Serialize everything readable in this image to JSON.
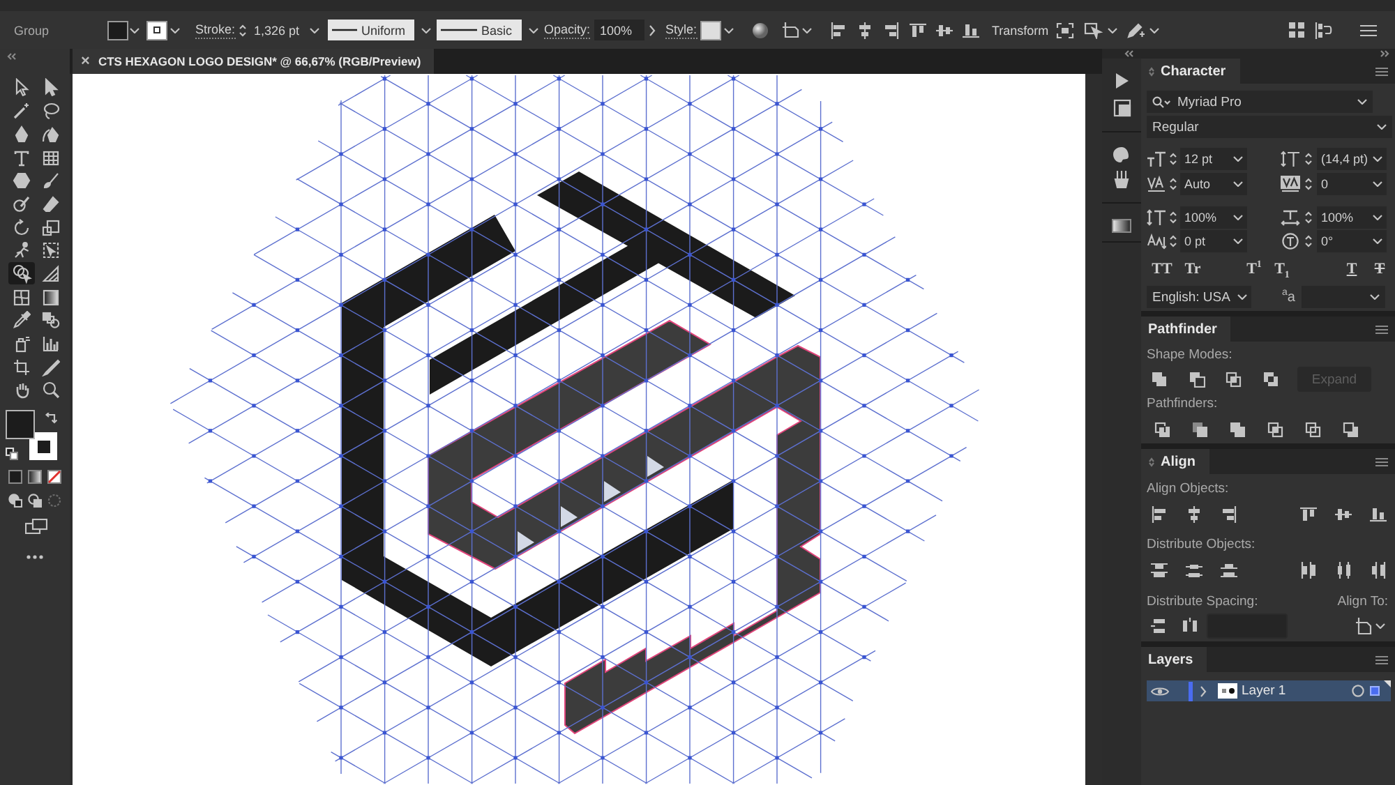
{
  "control_bar": {
    "selection": "Group",
    "stroke_label": "Stroke:",
    "stroke_weight": "1,326 pt",
    "profile": "Uniform",
    "brush": "Basic",
    "opacity_label": "Opacity:",
    "opacity": "100%",
    "style_label": "Style:",
    "transform_label": "Transform"
  },
  "document_tab": {
    "close": "×",
    "title": "CTS HEXAGON LOGO DESIGN* @ 66,67% (RGB/Preview)"
  },
  "tools": [
    {
      "selected": false
    },
    {
      "selected": false
    },
    {
      "selected": false
    },
    {
      "selected": false
    },
    {
      "selected": false
    },
    {
      "selected": false
    },
    {
      "selected": false
    },
    {
      "selected": false
    },
    {
      "selected": false
    },
    {
      "selected": false
    },
    {
      "selected": false
    },
    {
      "selected": false
    },
    {
      "selected": false
    },
    {
      "selected": false
    },
    {
      "selected": false
    },
    {
      "selected": false
    },
    {
      "selected": true
    },
    {
      "selected": false
    },
    {
      "selected": false
    },
    {
      "selected": false
    },
    {
      "selected": false
    },
    {
      "selected": false
    },
    {
      "selected": false
    },
    {
      "selected": false
    },
    {
      "selected": false
    },
    {
      "selected": false
    },
    {
      "selected": false
    },
    {
      "selected": false
    }
  ],
  "character_panel": {
    "tab": "Character",
    "font_family": "Myriad Pro",
    "font_style": "Regular",
    "fields": [
      "12 pt",
      "(14,4 pt)",
      "Auto",
      "0",
      "100%",
      "100%",
      "0 pt",
      "0°"
    ],
    "type_buttons": [
      {
        "label": "TT",
        "kind": "plain"
      },
      {
        "label": "Tr",
        "kind": "plain"
      },
      {
        "label": "T$^{1}$",
        "kind": "plain"
      },
      {
        "label": "T$_{1}$",
        "kind": "plain"
      },
      {
        "label": "T",
        "kind": "underline"
      },
      {
        "label": "T",
        "kind": "strike"
      }
    ],
    "language": "English: USA",
    "antialias": "$^{a}$a"
  },
  "pathfinder_panel": {
    "tab": "Pathfinder",
    "shape_modes_label": "Shape Modes:",
    "expand_button": {
      "label": "Expand",
      "disabled": true
    },
    "pathfinders_label": "Pathfinders:"
  },
  "align_panel": {
    "tab": "Align",
    "align_objects_label": "Align Objects:",
    "distribute_objects_label": "Distribute Objects:",
    "distribute_spacing_label": "Distribute Spacing:",
    "align_to_label": "Align To:"
  },
  "layers_panel": {
    "tab": "Layers",
    "layers": [
      {
        "name": "Layer 1",
        "visible": true,
        "selected": true,
        "color": "#4a6cf0"
      }
    ]
  }
}
